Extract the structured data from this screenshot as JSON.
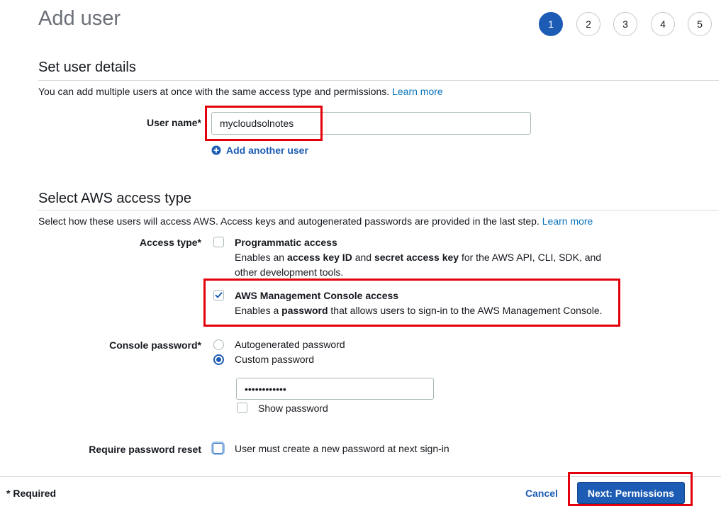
{
  "header": {
    "title": "Add user",
    "steps": [
      "1",
      "2",
      "3",
      "4",
      "5"
    ],
    "active_step": "1"
  },
  "details": {
    "title": "Set user details",
    "description": "You can add multiple users at once with the same access type and permissions.",
    "learn_more": "Learn more",
    "user_name_label": "User name*",
    "user_name_value": "mycloudsolnotes",
    "add_another_user": "Add another user"
  },
  "access": {
    "title": "Select AWS access type",
    "description": "Select how these users will access AWS. Access keys and autogenerated passwords are provided in the last step.",
    "learn_more": "Learn more",
    "access_type_label": "Access type*",
    "programmatic": {
      "title": "Programmatic access",
      "desc_1": "Enables an ",
      "desc_bold_1": "access key ID",
      "desc_2": " and ",
      "desc_bold_2": "secret access key",
      "desc_3": " for the AWS API, CLI, SDK, and",
      "desc_line2": "other development tools.",
      "checked": false
    },
    "console": {
      "title": "AWS Management Console access",
      "desc_1": "Enables a ",
      "desc_bold": "password",
      "desc_2": " that allows users to sign-in to the AWS Management Console.",
      "checked": true
    },
    "console_password_label": "Console password*",
    "password_options": [
      "Autogenerated password",
      "Custom password"
    ],
    "selected_password_option": "Custom password",
    "password_value": "••••••••••••",
    "show_password": "Show password",
    "reset_label": "Require password reset",
    "reset_text": "User must create a new password at next sign-in"
  },
  "footer": {
    "required_note": "* Required",
    "cancel": "Cancel",
    "next": "Next: Permissions"
  },
  "colors": {
    "primary": "#1d5cb4",
    "link": "#0a73bb",
    "highlight": "#e3000b"
  }
}
